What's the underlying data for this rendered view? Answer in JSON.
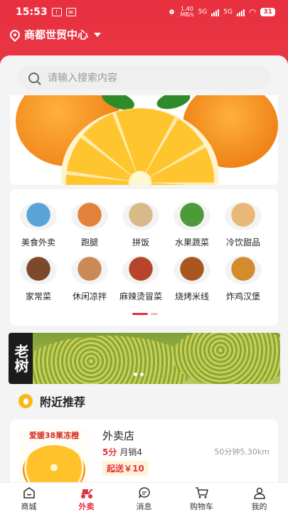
{
  "status_bar": {
    "time": "15:53",
    "network_speed": "1.40\nMB/s",
    "network_1": "5G",
    "network_2": "5G",
    "battery": "31"
  },
  "header": {
    "location": "商都世贸中心"
  },
  "search": {
    "placeholder": "请输入搜索内容"
  },
  "categories": [
    {
      "label": "美食外卖",
      "icon": "laptop-food-icon",
      "color": "#5aa4d6"
    },
    {
      "label": "跑腿",
      "icon": "delivery-plate-icon",
      "color": "#e2813a"
    },
    {
      "label": "拼饭",
      "icon": "rice-plate-icon",
      "color": "#d9b98a"
    },
    {
      "label": "水果蔬菜",
      "icon": "fruit-veg-icon",
      "color": "#4c9a3a"
    },
    {
      "label": "冷饮甜品",
      "icon": "dessert-icon",
      "color": "#e7b878"
    },
    {
      "label": "家常菜",
      "icon": "home-dish-icon",
      "color": "#7a4a2a"
    },
    {
      "label": "休闲凉拌",
      "icon": "cold-dish-icon",
      "color": "#c98a55"
    },
    {
      "label": "麻辣烫冒菜",
      "icon": "spicy-pot-icon",
      "color": "#b5462c"
    },
    {
      "label": "烧烤米线",
      "icon": "bbq-icon",
      "color": "#a8561e"
    },
    {
      "label": "炸鸡汉堡",
      "icon": "fried-chicken-icon",
      "color": "#d68a2e"
    }
  ],
  "banner": {
    "sign_text": "老树"
  },
  "nearby": {
    "title": "附近推荐"
  },
  "store": {
    "thumb_text": "爱媛38果冻橙",
    "name": "外卖店",
    "rating": "5分",
    "sales": "月销4",
    "distance": "50分钟5.30km",
    "min_order": "起送￥10"
  },
  "nav": [
    {
      "label": "商城",
      "icon": "home-icon",
      "active": false
    },
    {
      "label": "外卖",
      "icon": "scooter-icon",
      "active": true
    },
    {
      "label": "消息",
      "icon": "chat-icon",
      "active": false
    },
    {
      "label": "购物车",
      "icon": "cart-icon",
      "active": false
    },
    {
      "label": "我的",
      "icon": "user-icon",
      "active": false
    }
  ],
  "colors": {
    "brand_red": "#e8303f",
    "accent_yellow": "#f5b91b"
  }
}
